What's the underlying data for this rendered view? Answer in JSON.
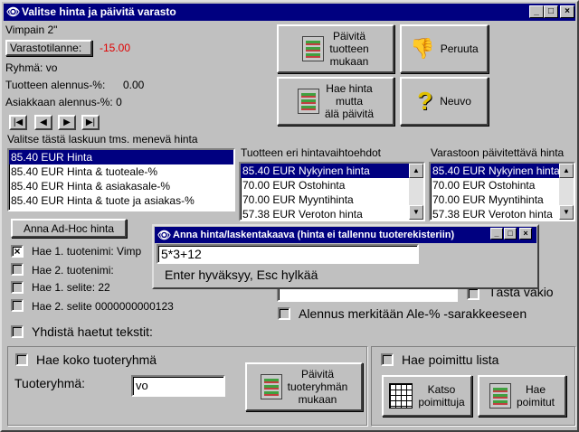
{
  "window": {
    "title": "Valitse hinta ja päivitä varasto",
    "min": "_",
    "max": "□",
    "close": "×"
  },
  "product": {
    "name": "Vimpain 2\"",
    "stock_button": "Varastotilanne:",
    "stock_value": "-15.00",
    "group_label": "Ryhmä:",
    "group_value": "vo",
    "prod_discount_label": "Tuotteen alennus-%:",
    "prod_discount_value": "0.00",
    "cust_discount_label": "Asiakkaan alennus-%:",
    "cust_discount_value": "0"
  },
  "actions": {
    "update": "Päivitä\ntuotteen\nmukaan",
    "cancel": "Peruuta",
    "fetch": "Hae hinta\nmutta\nälä päivitä",
    "advice": "Neuvo"
  },
  "nav": [
    "|◀",
    "◀",
    "▶",
    "▶|"
  ],
  "price_list": {
    "label": "Valitse tästä laskuun tms. menevä hinta",
    "rows": [
      "85.40 EUR Hinta",
      "85.40 EUR  Hinta & tuoteale-%",
      "85.40 EUR  Hinta & asiakasale-%",
      "85.40 EUR  Hinta & tuote ja asiakas-%"
    ]
  },
  "alt_list": {
    "label": "Tuotteen eri hintavaihtoehdot",
    "rows": [
      "85.40 EUR Nykyinen hinta",
      "70.00 EUR Ostohinta",
      "70.00 EUR Myyntihinta",
      "57.38 EUR Veroton hinta"
    ]
  },
  "stock_list": {
    "label": "Varastoon päivitettävä hinta",
    "rows": [
      "85.40 EUR Nykyinen hinta",
      "70.00 EUR Ostohinta",
      "70.00 EUR Myyntihinta",
      "57.38 EUR Veroton hinta"
    ]
  },
  "adhoc_button": "Anna Ad-Hoc hinta",
  "search_opts": [
    {
      "label": "Hae 1. tuotenimi: Vimp",
      "checked": true
    },
    {
      "label": "Hae 2. tuotenimi:",
      "checked": false
    },
    {
      "label": "Hae 1. selite: 22",
      "checked": false
    },
    {
      "label": "Hae 2. selite 0000000000123",
      "checked": false
    }
  ],
  "combine_label": "Yhdistä haetut tekstit:",
  "vakio_label": "Tästä vakio",
  "ale_label": "Alennus merkitään Ale-% -sarakkeeseen",
  "group_box": {
    "fetch_all": "Hae koko tuoteryhmä",
    "group_label": "Tuoteryhmä:",
    "group_value": "vo",
    "update_btn": "Päivitä\ntuoteryhmän\nmukaan"
  },
  "list_box": {
    "fetch_picked": "Hae poimittu lista",
    "view_btn": "Katso\npoimittuja",
    "fetch_btn": "Hae\npoimitut"
  },
  "dialog": {
    "title": "Anna hinta/laskentakaava (hinta ei tallennu tuoterekisteriin)",
    "input_value": "5*3+12",
    "hint": "Enter hyväksyy, Esc hylkää"
  }
}
